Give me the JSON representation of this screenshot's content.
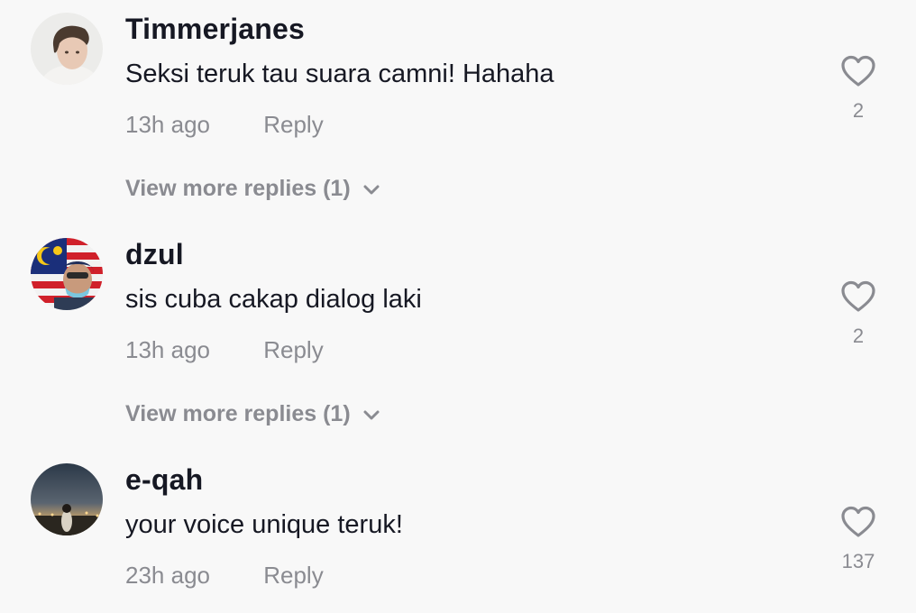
{
  "comments": [
    {
      "username": "Timmerjanes",
      "text": "Seksi teruk tau suara camni! Hahaha",
      "time": "13h ago",
      "reply_label": "Reply",
      "likes": "2",
      "view_more": "View more replies (1)",
      "avatar_icon": "avatar-photo"
    },
    {
      "username": "dzul",
      "text": "sis cuba cakap dialog laki",
      "time": "13h ago",
      "reply_label": "Reply",
      "likes": "2",
      "view_more": "View more replies (1)",
      "avatar_icon": "avatar-photo"
    },
    {
      "username": "e-qah",
      "text": "your voice unique teruk!",
      "time": "23h ago",
      "reply_label": "Reply",
      "likes": "137",
      "avatar_icon": "avatar-photo"
    }
  ],
  "icons": {
    "like": "heart-outline-icon",
    "expand": "chevron-down-icon"
  },
  "colors": {
    "background": "#f8f8f8",
    "primary_text": "#161823",
    "secondary_text": "#8a8b91"
  }
}
